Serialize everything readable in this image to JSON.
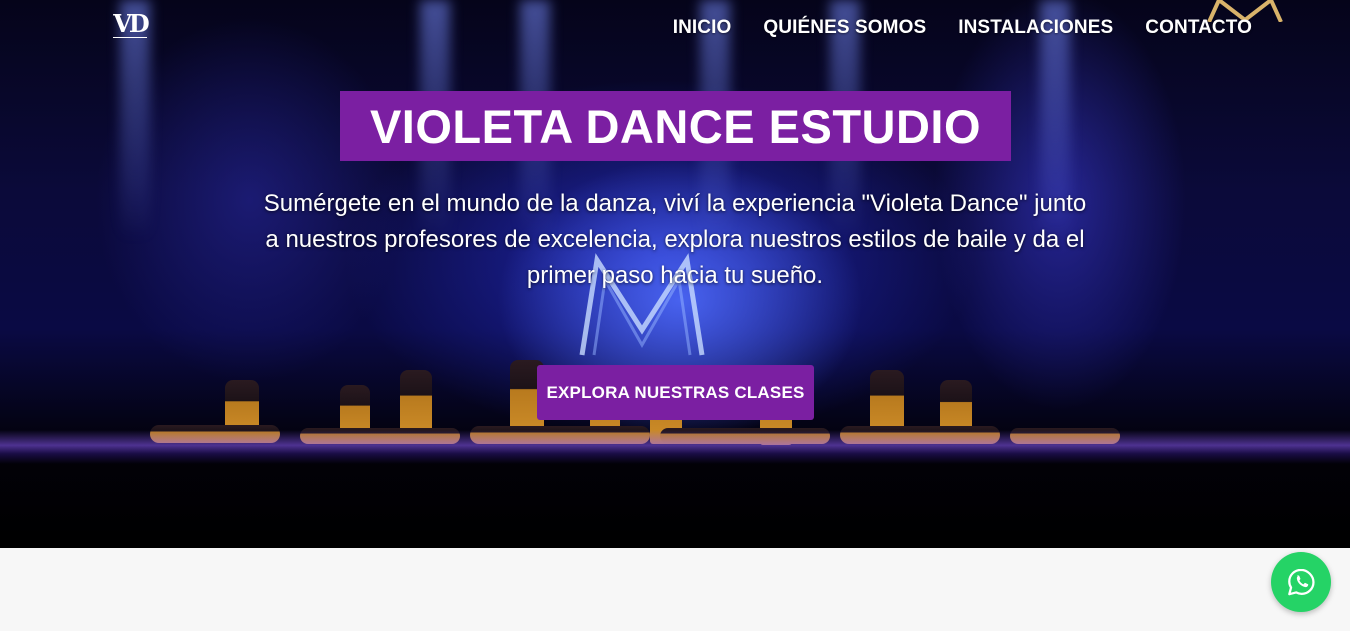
{
  "logo": {
    "text": "VD"
  },
  "nav": {
    "items": [
      {
        "label": "INICIO"
      },
      {
        "label": "QUIÉNES SOMOS"
      },
      {
        "label": "INSTALACIONES"
      },
      {
        "label": "CONTACTO"
      }
    ]
  },
  "hero": {
    "title": "VIOLETA DANCE ESTUDIO",
    "subtitle": "Sumérgete en el mundo de la danza, viví la experiencia \"Violeta Dance\" junto a nuestros profesores de excelencia, explora nuestros estilos de baile y da el primer paso hacia tu sueño.",
    "cta_label": "EXPLORA NUESTRAS CLASES"
  },
  "floating": {
    "icon": "whatsapp-icon"
  },
  "colors": {
    "accent": "#7b1fa2",
    "whatsapp": "#25d366",
    "background": "#f7f7f7"
  }
}
